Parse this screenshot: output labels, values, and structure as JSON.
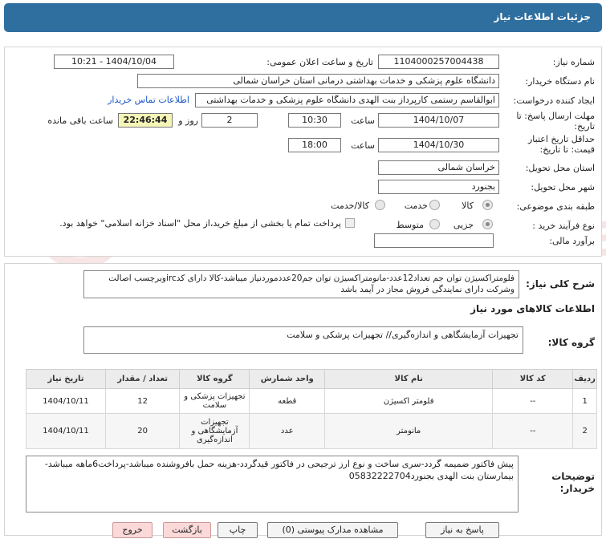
{
  "header": {
    "title": "جزئیات اطلاعات نیاز"
  },
  "fields": {
    "need_number_label": "شماره نیاز:",
    "need_number": "1104000257004438",
    "announce_label": "تاریخ و ساعت اعلان عمومی:",
    "announce_value": "1404/10/04 - 10:21",
    "buyer_org_label": "نام دستگاه خریدار:",
    "buyer_org": "دانشگاه علوم پزشکی و خدمات بهداشتی درمانی استان خراسان شمالی",
    "creator_label": "ایجاد کننده درخواست:",
    "creator": "ابوالقاسم رستمی کارپرداز بنت الهدی دانشگاه علوم پزشکی و خدمات بهداشتی",
    "contact_link": "اطلاعات تماس خریدار",
    "deadline_label": "مهلت ارسال پاسخ: تا تاریخ:",
    "deadline_date": "1404/10/07",
    "time_label": "ساعت",
    "deadline_time": "10:30",
    "days_value": "2",
    "days_label": "روز و",
    "remaining_time": "22:46:44",
    "remaining_label": "ساعت باقی مانده",
    "validity_label": "حداقل تاریخ اعتبار قیمت: تا تاریخ:",
    "validity_date": "1404/10/30",
    "validity_time": "18:00",
    "province_label": "استان محل تحویل:",
    "province": "خراسان شمالی",
    "city_label": "شهر محل تحویل:",
    "city": "بجنورد",
    "category_label": "طبقه بندی موضوعی:",
    "cat_goods": "کالا",
    "cat_service": "خدمت",
    "cat_goods_service": "کالا/خدمت",
    "process_label": "نوع فرآیند خرید :",
    "proc_partial": "جزیی",
    "proc_medium": "متوسط",
    "payment_note": "پرداخت تمام یا بخشی از مبلغ خرید،از محل \"اسناد خزانه اسلامی\" خواهد بود.",
    "estimate_label": "برآورد مالی:",
    "estimate_value": ""
  },
  "summary": {
    "label": "شرح کلی نیاز:",
    "text": "فلومتراکسیژن توان جم تعداد12عدد-مانومتراکسیژن توان جم20عددموردنیاز میباشد-کالا دارای کدircوبرچسب اصالت وشرکت دارای نمایندگی فروش مجاز در آیمد باشد"
  },
  "goods_info_title": "اطلاعات کالاهای مورد نیاز",
  "goods_group": {
    "label": "گروه کالا:",
    "value": "تجهیزات آزمایشگاهی و اندازه‌گیری// تجهیزات پزشکی و سلامت"
  },
  "table": {
    "headers": [
      "ردیف",
      "کد کالا",
      "نام کالا",
      "واحد شمارش",
      "گروه کالا",
      "تعداد / مقدار",
      "تاریخ نیاز"
    ],
    "rows": [
      [
        "1",
        "--",
        "فلومتر اکسیژن",
        "قطعه",
        "تجهیزات پزشکی و سلامت",
        "12",
        "1404/10/11"
      ],
      [
        "2",
        "--",
        "مانومتر",
        "عدد",
        "تجهیزات آزمایشگاهی و اندازه‌گیری",
        "20",
        "1404/10/11"
      ]
    ]
  },
  "buyer_notes": {
    "label": "توضیحات خریدار:",
    "text": "پیش فاکتور ضمیمه گردد-سری ساخت و نوع ارز ترجیحی در فاکتور قیدگردد-هزینه حمل بافروشنده میباشد-پرداخت6ماهه میباشد-بیمارستان بنت الهدی بجنورد05832222704"
  },
  "buttons": {
    "reply": "پاسخ به نیاز",
    "attachments": "مشاهده مدارک پیوستی (0)",
    "print": "چاپ",
    "back": "بازگشت",
    "exit": "خروج"
  },
  "watermark": "AriaTender.neT",
  "colors": {
    "header": "#2f6fa0",
    "link": "#1a55c8",
    "remaining_bg": "#f5f5b8"
  }
}
